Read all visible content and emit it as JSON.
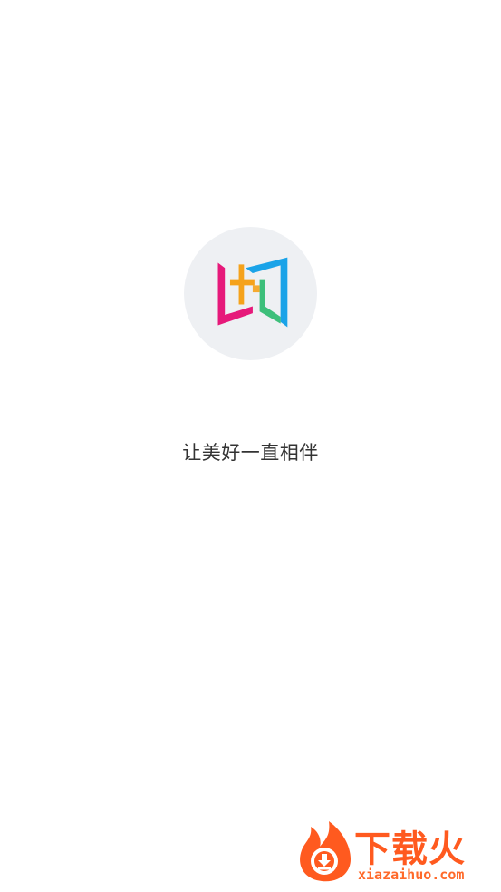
{
  "app": {
    "logo_icon": "app-logo-icon",
    "tagline": "让美好一直相伴"
  },
  "watermark": {
    "icon": "flame-download-icon",
    "title": "下载火",
    "url": "xiazaihuo.com",
    "color": "#ff5a1f"
  },
  "colors": {
    "background": "#ffffff",
    "logo_circle": "#eef0f3",
    "logo_pink": "#e6197a",
    "logo_orange": "#f5a21b",
    "logo_blue": "#1aa3e8",
    "logo_green": "#3dbf7a",
    "tagline": "#333333"
  }
}
